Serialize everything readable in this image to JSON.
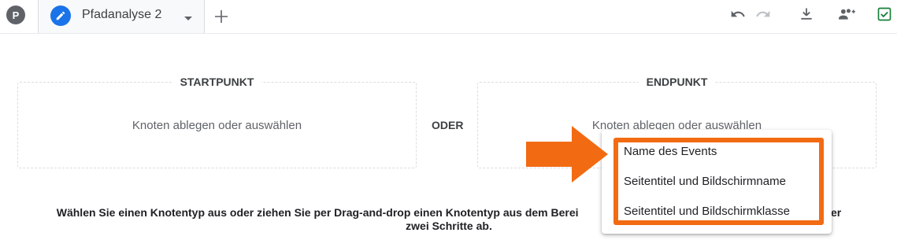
{
  "topbar": {
    "avatar_letter": "P",
    "tab": {
      "label": "Pfadanalyse 2"
    },
    "tools": [
      "undo-icon",
      "redo-icon",
      "download-icon",
      "share-users-icon",
      "save-check-icon"
    ],
    "colors": {
      "accent": "#1a73e8",
      "save_check": "#188038"
    }
  },
  "canvas": {
    "start_box": {
      "title": "STARTPUNKT",
      "placeholder": "Knoten ablegen oder auswählen"
    },
    "or_label": "ODER",
    "end_box": {
      "title": "ENDPUNKT",
      "placeholder": "Knoten ablegen oder auswählen"
    },
    "instructions_visible": "Wählen Sie einen Knotentyp aus oder ziehen Sie per Drag-and-drop einen Knotentyp aus dem Berei",
    "instructions_right": "em der",
    "instructions_line2": "zwei Schritte ab."
  },
  "dropdown": {
    "items": [
      "Name des Events",
      "Seitentitel und Bildschirmname",
      "Seitentitel und Bildschirmklasse"
    ]
  },
  "annotation": {
    "highlight_color": "#f26b13"
  }
}
